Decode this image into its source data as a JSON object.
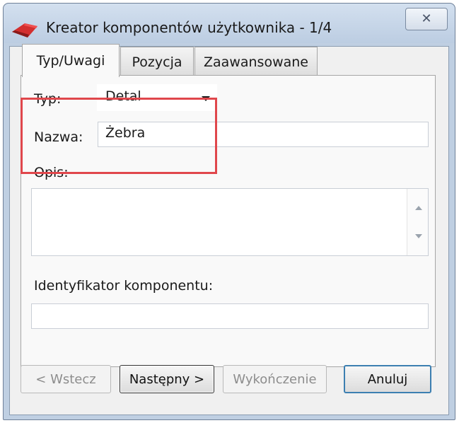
{
  "window": {
    "title": "Kreator komponentów użytkownika - 1/4",
    "close_glyph": "✕",
    "icon": "red-ruler-app-icon"
  },
  "tabs": [
    {
      "label": "Typ/Uwagi",
      "active": true
    },
    {
      "label": "Pozycja",
      "active": false
    },
    {
      "label": "Zaawansowane",
      "active": false
    }
  ],
  "form": {
    "type_label": "Typ:",
    "type_value": "Detal",
    "name_label": "Nazwa:",
    "name_value": "Żebra",
    "description_label": "Opis:",
    "description_value": "",
    "component_id_label": "Identyfikator komponentu:",
    "component_id_value": ""
  },
  "buttons": {
    "back": "< Wstecz",
    "next": "Następny >",
    "finish": "Wykończenie",
    "cancel": "Anuluj"
  },
  "colors": {
    "highlight": "#e0474c",
    "window_frame": "#bfcfe2"
  }
}
